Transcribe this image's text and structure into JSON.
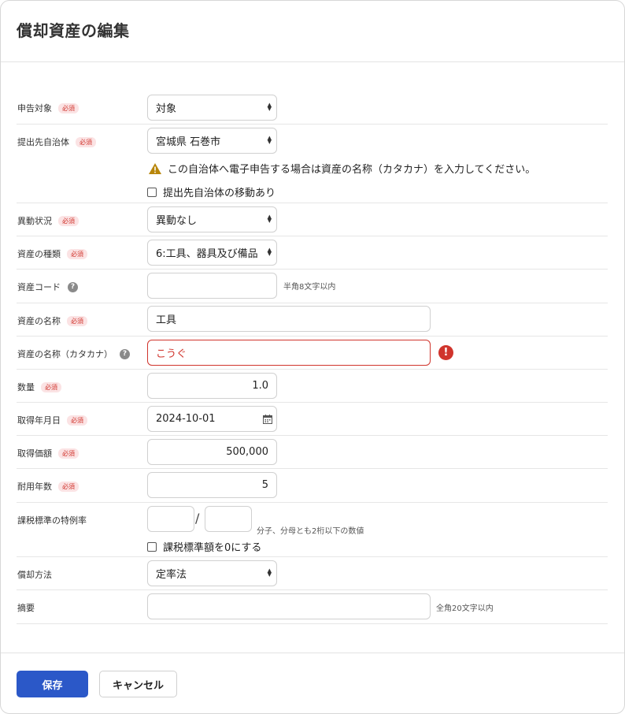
{
  "dialog": {
    "title": "償却資産の編集",
    "required_badge": "必須"
  },
  "fields": {
    "declaration_target": {
      "label": "申告対象",
      "value": "対象"
    },
    "submission_municipality": {
      "label": "提出先自治体",
      "value": "宮城県 石巻市",
      "warning": "この自治体へ電子申告する場合は資産の名称（カタカナ）を入力してください。",
      "checkbox_label": "提出先自治体の移動あり",
      "checkbox_checked": false
    },
    "change_status": {
      "label": "異動状況",
      "value": "異動なし"
    },
    "asset_type": {
      "label": "資産の種類",
      "value": "6:工具、器具及び備品"
    },
    "asset_code": {
      "label": "資産コード",
      "value": "",
      "hint": "半角8文字以内"
    },
    "asset_name": {
      "label": "資産の名称",
      "value": "工具"
    },
    "asset_name_kana": {
      "label": "資産の名称（カタカナ）",
      "value": "こうぐ",
      "error_icon": "!"
    },
    "quantity": {
      "label": "数量",
      "value": "1.0"
    },
    "acquisition_date": {
      "label": "取得年月日",
      "value": "2024-10-01"
    },
    "acquisition_price": {
      "label": "取得価額",
      "value": "500,000"
    },
    "useful_life": {
      "label": "耐用年数",
      "value": "5"
    },
    "special_rate": {
      "label": "課税標準の特例率",
      "numerator": "",
      "separator": "/",
      "denominator": "",
      "hint": "分子、分母とも2桁以下の数値",
      "checkbox_label": "課税標準額を0にする",
      "checkbox_checked": false
    },
    "depreciation_method": {
      "label": "償却方法",
      "value": "定率法"
    },
    "summary": {
      "label": "摘要",
      "value": "",
      "hint": "全角20文字以内"
    }
  },
  "footer": {
    "save_label": "保存",
    "cancel_label": "キャンセル"
  },
  "icons": {
    "help": "?",
    "select_arrow_up": "▲",
    "select_arrow_down": "▼",
    "warning": "warning-triangle-icon",
    "calendar": "calendar-icon"
  },
  "colors": {
    "primary": "#2b58c8",
    "error": "#d0342c",
    "warning": "#b8860b",
    "required_bg": "#fbe3e4"
  }
}
